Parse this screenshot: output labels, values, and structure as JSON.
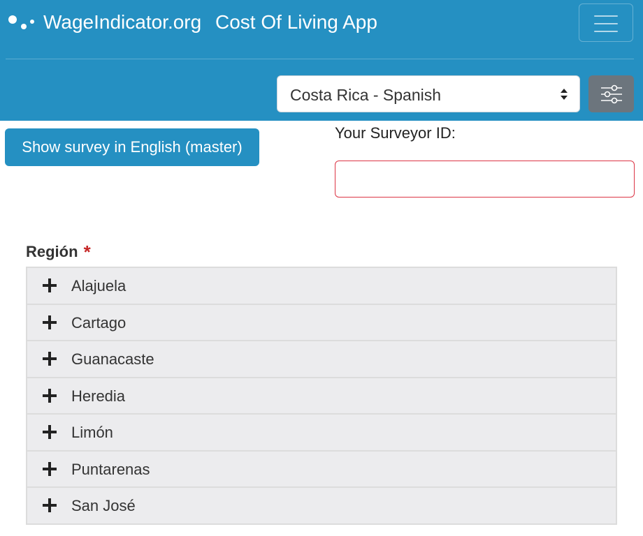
{
  "header": {
    "site_name": "WageIndicator.org",
    "app_name": "Cost Of Living App",
    "logo_icon": "wageindicator-dots-logo",
    "menu_icon": "hamburger-menu-icon",
    "background_color": "#2590c2"
  },
  "language_select": {
    "selected": "Costa Rica - Spanish",
    "icon": "select-caret-updown-icon"
  },
  "filter_button": {
    "icon": "sliders-settings-icon",
    "color": "#6c757d"
  },
  "english_button": {
    "label": "Show survey in English (master)",
    "color": "#2590c2"
  },
  "surveyor": {
    "label": "Your Surveyor ID:",
    "value": "",
    "border_color": "#dc3545"
  },
  "region": {
    "label": "Región",
    "required_mark": "*",
    "expand_icon": "plus-icon",
    "items": [
      {
        "label": "Alajuela"
      },
      {
        "label": "Cartago"
      },
      {
        "label": "Guanacaste"
      },
      {
        "label": "Heredia"
      },
      {
        "label": "Limón"
      },
      {
        "label": "Puntarenas"
      },
      {
        "label": "San José"
      }
    ]
  }
}
